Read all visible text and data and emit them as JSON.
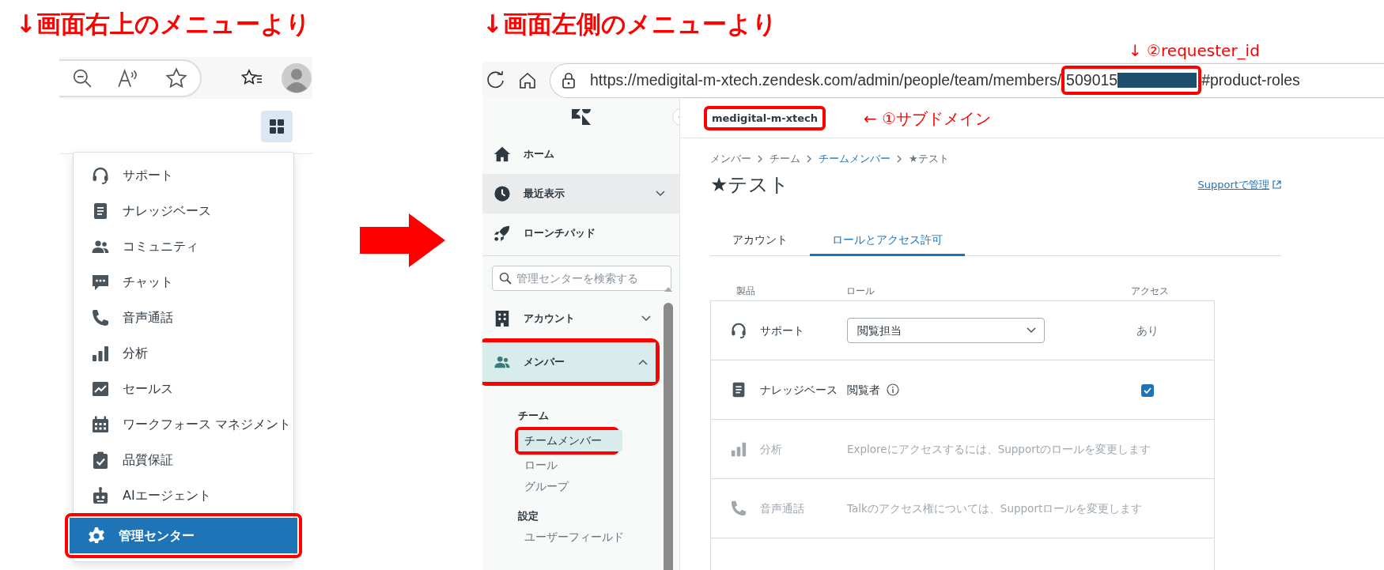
{
  "left_panel": {
    "heading": "↓画面右上のメニューより",
    "menu_items": [
      {
        "label": "サポート",
        "selected": false,
        "outlined": false
      },
      {
        "label": "ナレッジベース",
        "selected": false,
        "outlined": false
      },
      {
        "label": "コミュニティ",
        "selected": false,
        "outlined": false
      },
      {
        "label": "チャット",
        "selected": false,
        "outlined": false
      },
      {
        "label": "音声通話",
        "selected": false,
        "outlined": false
      },
      {
        "label": "分析",
        "selected": false,
        "outlined": false
      },
      {
        "label": "セールス",
        "selected": false,
        "outlined": false
      },
      {
        "label": "ワークフォース マネジメント",
        "selected": false,
        "outlined": false
      },
      {
        "label": "品質保証",
        "selected": false,
        "outlined": false
      },
      {
        "label": "AIエージェント",
        "selected": false,
        "outlined": false
      },
      {
        "label": "管理センター",
        "selected": true,
        "outlined": true
      }
    ]
  },
  "right_panel": {
    "heading": "↓画面左側のメニューより",
    "id_annotation": "↓ ②requester_id",
    "url": {
      "start": "https://medigital-m-xtech.zendesk.com/admin/people/team/members/",
      "id_prefix": "509015",
      "end": "#product-roles"
    },
    "subdomain": "medigital-m-xtech",
    "subdomain_annotation": "← ①サブドメイン",
    "sidebar": {
      "top_items": [
        {
          "label": "ホーム",
          "hovered": false
        },
        {
          "label": "最近表示",
          "hovered": true,
          "expanded": false
        },
        {
          "label": "ローンチパッド",
          "hovered": false
        }
      ],
      "search": {
        "placeholder": "管理センターを検索する"
      },
      "items": [
        {
          "label": "アカウント",
          "selected": false,
          "expanded": false,
          "outlined": false
        },
        {
          "label": "メンバー",
          "selected": true,
          "expanded": true,
          "outlined": true
        }
      ],
      "sections": [
        {
          "heading": "チーム",
          "items": [
            {
              "label": "チームメンバー",
              "selected": true,
              "outlined": true
            },
            {
              "label": "ロール",
              "selected": false,
              "outlined": false
            },
            {
              "label": "グループ",
              "selected": false,
              "outlined": false
            }
          ]
        },
        {
          "heading": "設定",
          "items": [
            {
              "label": "ユーザーフィールド",
              "selected": false,
              "outlined": false
            }
          ]
        }
      ]
    },
    "breadcrumb": [
      {
        "label": "メンバー",
        "link": false
      },
      {
        "label": "チーム",
        "link": false
      },
      {
        "label": "チームメンバー",
        "link": true
      },
      {
        "label": "★テスト",
        "link": false
      }
    ],
    "title": "★テスト",
    "manage_link": "Supportで管理",
    "tabs": [
      {
        "label": "アカウント",
        "selected": false
      },
      {
        "label": "ロールとアクセス許可",
        "selected": true
      }
    ],
    "table": {
      "columns": [
        "製品",
        "ロール",
        "アクセス"
      ],
      "rows": [
        {
          "product": "サポート",
          "kind": "select",
          "role": "閲覧担当",
          "access": "あり",
          "disabled": false
        },
        {
          "product": "ナレッジベース",
          "kind": "info",
          "role": "閲覧者",
          "checked": true,
          "disabled": false
        },
        {
          "product": "分析",
          "kind": "message",
          "role": "Exploreにアクセスするには、Supportのロールを変更します",
          "disabled": true
        },
        {
          "product": "音声通話",
          "kind": "message",
          "role": "Talkのアクセス権については、Supportロールを変更します",
          "disabled": true
        }
      ]
    }
  }
}
